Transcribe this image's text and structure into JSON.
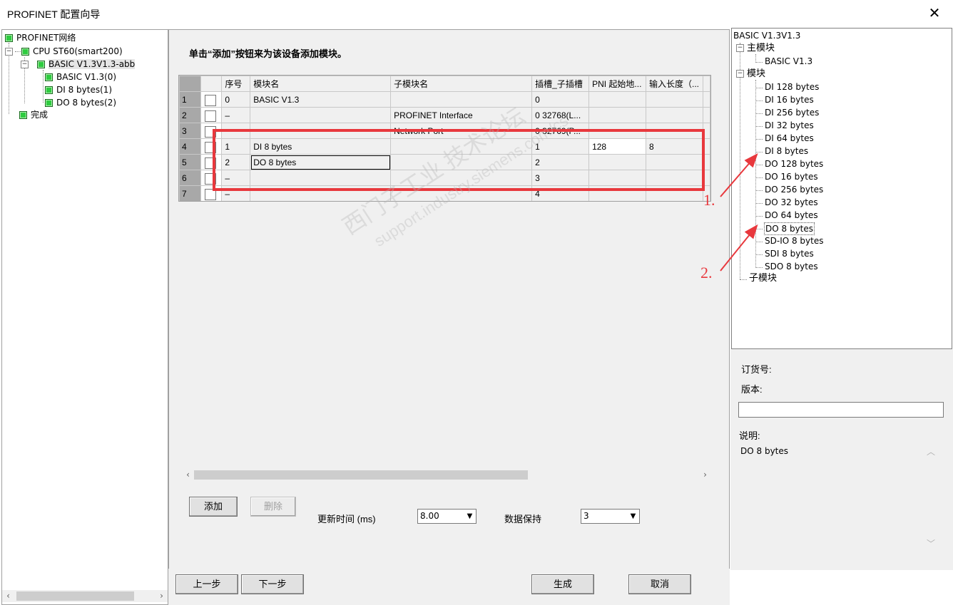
{
  "window": {
    "title": "PROFINET 配置向导",
    "close_glyph": "✕"
  },
  "left_tree": {
    "items": [
      {
        "label": "PROFINET网络"
      },
      {
        "label": "CPU ST60(smart200)"
      },
      {
        "label": "BASIC V1.3V1.3-abb"
      },
      {
        "label": "BASIC V1.3(0)"
      },
      {
        "label": "DI 8 bytes(1)"
      },
      {
        "label": "DO 8 bytes(2)"
      },
      {
        "label": "完成"
      }
    ]
  },
  "main": {
    "instruction": "单击“添加”按钮来为该设备添加模块。",
    "grid": {
      "headers": [
        "序号",
        "模块名",
        "子模块名",
        "插槽_子插槽",
        "PNI 起始地...",
        "输入长度（..."
      ],
      "rows": [
        {
          "num": "1",
          "seq": "0",
          "module": "BASIC V1.3",
          "submodule": "",
          "slot": "0",
          "pni": "",
          "inlen": ""
        },
        {
          "num": "2",
          "seq": "–",
          "module": "",
          "submodule": "PROFINET Interface",
          "slot": "0 32768(L...",
          "pni": "",
          "inlen": ""
        },
        {
          "num": "3",
          "seq": "",
          "module": "",
          "submodule": "Network Port",
          "slot": "0 32769(P...",
          "pni": "",
          "inlen": ""
        },
        {
          "num": "4",
          "seq": "1",
          "module": "DI 8 bytes",
          "submodule": "",
          "slot": "1",
          "pni": "128",
          "inlen": "8"
        },
        {
          "num": "5",
          "seq": "2",
          "module": "DO 8 bytes",
          "submodule": "",
          "slot": "2",
          "pni": "",
          "inlen": ""
        },
        {
          "num": "6",
          "seq": "–",
          "module": "",
          "submodule": "",
          "slot": "3",
          "pni": "",
          "inlen": ""
        },
        {
          "num": "7",
          "seq": "–",
          "module": "",
          "submodule": "",
          "slot": "4",
          "pni": "",
          "inlen": ""
        }
      ]
    },
    "add_button": "添加",
    "delete_button": "删除",
    "update_time_label": "更新时间 (ms)",
    "update_time_value": "8.00",
    "data_hold_label": "数据保持",
    "data_hold_value": "3"
  },
  "right_tree": {
    "root": "BASIC V1.3V1.3",
    "main_module_group": "主模块",
    "main_module_item": "BASIC V1.3",
    "module_group": "模块",
    "modules": [
      "DI 128 bytes",
      "DI 16 bytes",
      "DI 256 bytes",
      "DI 32 bytes",
      "DI 64 bytes",
      "DI 8 bytes",
      "DO 128 bytes",
      "DO 16 bytes",
      "DO 256 bytes",
      "DO 32 bytes",
      "DO 64 bytes",
      "DO 8 bytes",
      "SD-IO 8 bytes",
      "SDI 8 bytes",
      "SDO 8 bytes"
    ],
    "submodule_group": "子模块"
  },
  "info": {
    "order_label": "订货号:",
    "version_label": "版本:",
    "version_value": "",
    "desc_label": "说明:",
    "desc_value": "DO 8 bytes"
  },
  "bottom": {
    "prev": "上一步",
    "next": "下一步",
    "generate": "生成",
    "cancel": "取消"
  },
  "annotations": {
    "one": "1.",
    "two": "2."
  },
  "colors": {
    "highlight_red": "#e8383d",
    "tree_check_green": "#2ecc40",
    "row_header_gray": "#a8a8a8"
  }
}
